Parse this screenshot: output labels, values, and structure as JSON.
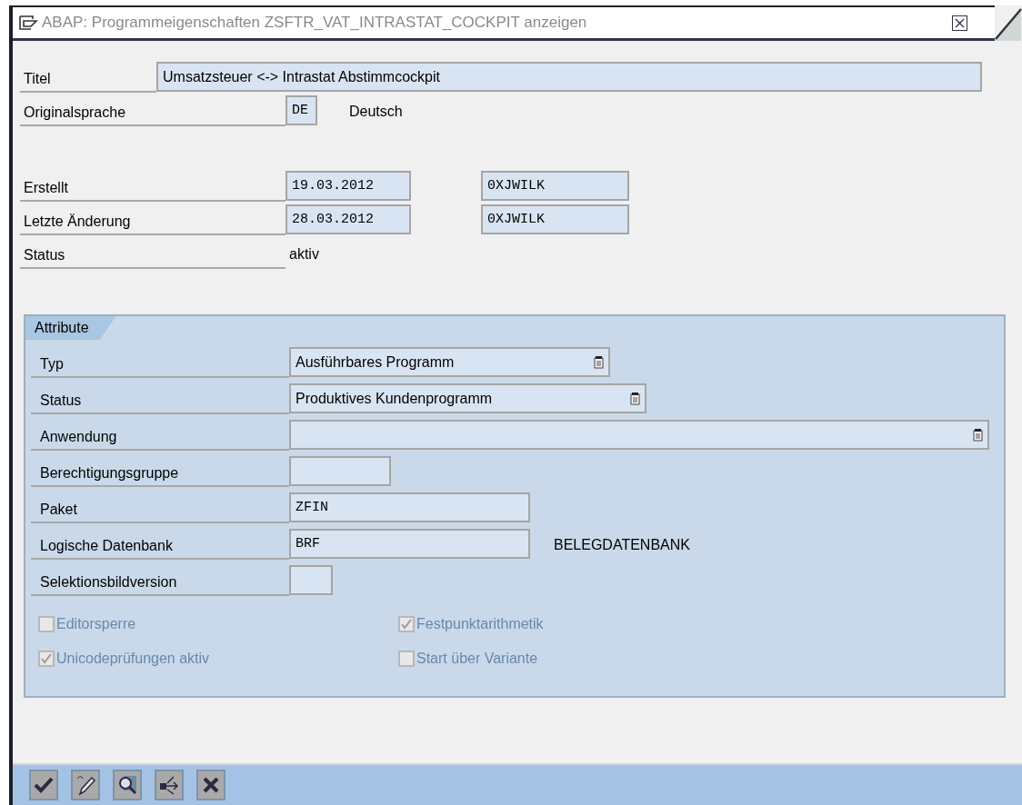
{
  "window": {
    "title": "ABAP: Programmeigenschaften ZSFTR_VAT_INTRASTAT_COCKPIT anzeigen"
  },
  "header_rows": [
    {
      "label": "Titel",
      "fields": [
        {
          "kind": "text",
          "value": "Umsatzsteuer <-> Intrastat Abstimmcockpit"
        }
      ]
    },
    {
      "label": "Originalsprache",
      "fields": [
        {
          "kind": "mono",
          "value": "DE"
        }
      ],
      "note": "Deutsch"
    },
    {
      "label": "Erstellt",
      "fields": [
        {
          "kind": "mono",
          "value": "19.03.2012"
        },
        {
          "kind": "mono",
          "value": "0XJWILK"
        }
      ]
    },
    {
      "label": "Letzte Änderung",
      "fields": [
        {
          "kind": "mono",
          "value": "28.03.2012"
        },
        {
          "kind": "mono",
          "value": "0XJWILK"
        }
      ]
    },
    {
      "label": "Status",
      "note": "aktiv"
    }
  ],
  "attributes": {
    "title": "Attribute",
    "rows": [
      {
        "label": "Typ",
        "fields": [
          {
            "kind": "dropdown",
            "value": "Ausführbares Programm"
          }
        ]
      },
      {
        "label": "Status",
        "fields": [
          {
            "kind": "dropdown",
            "value": "Produktives Kundenprogramm"
          }
        ]
      },
      {
        "label": "Anwendung",
        "fields": [
          {
            "kind": "dropdown"
          }
        ]
      },
      {
        "label": "Berechtigungsgruppe",
        "fields": [
          {
            "kind": "mono"
          }
        ]
      },
      {
        "label": "Paket",
        "fields": [
          {
            "kind": "mono",
            "value": "ZFIN"
          }
        ]
      },
      {
        "label": "Logische Datenbank",
        "fields": [
          {
            "kind": "mono",
            "value": "BRF"
          }
        ],
        "note": "BELEGDATENBANK"
      },
      {
        "label": "Selektionsbildversion",
        "fields": [
          {
            "kind": "mono"
          }
        ]
      }
    ],
    "checkboxes": [
      {
        "label": "Editorsperre",
        "checked": false,
        "disabled": true
      },
      {
        "label": "Festpunktarithmetik",
        "checked": true,
        "disabled": true
      },
      {
        "label": "Unicodeprüfungen aktiv",
        "checked": true,
        "disabled": true
      },
      {
        "label": "Start über Variante",
        "checked": false,
        "disabled": true
      }
    ]
  },
  "toolbar": {
    "buttons": [
      {
        "kind": "confirm"
      },
      {
        "kind": "edit"
      },
      {
        "kind": "search"
      },
      {
        "kind": "export"
      },
      {
        "kind": "cancel"
      }
    ]
  }
}
